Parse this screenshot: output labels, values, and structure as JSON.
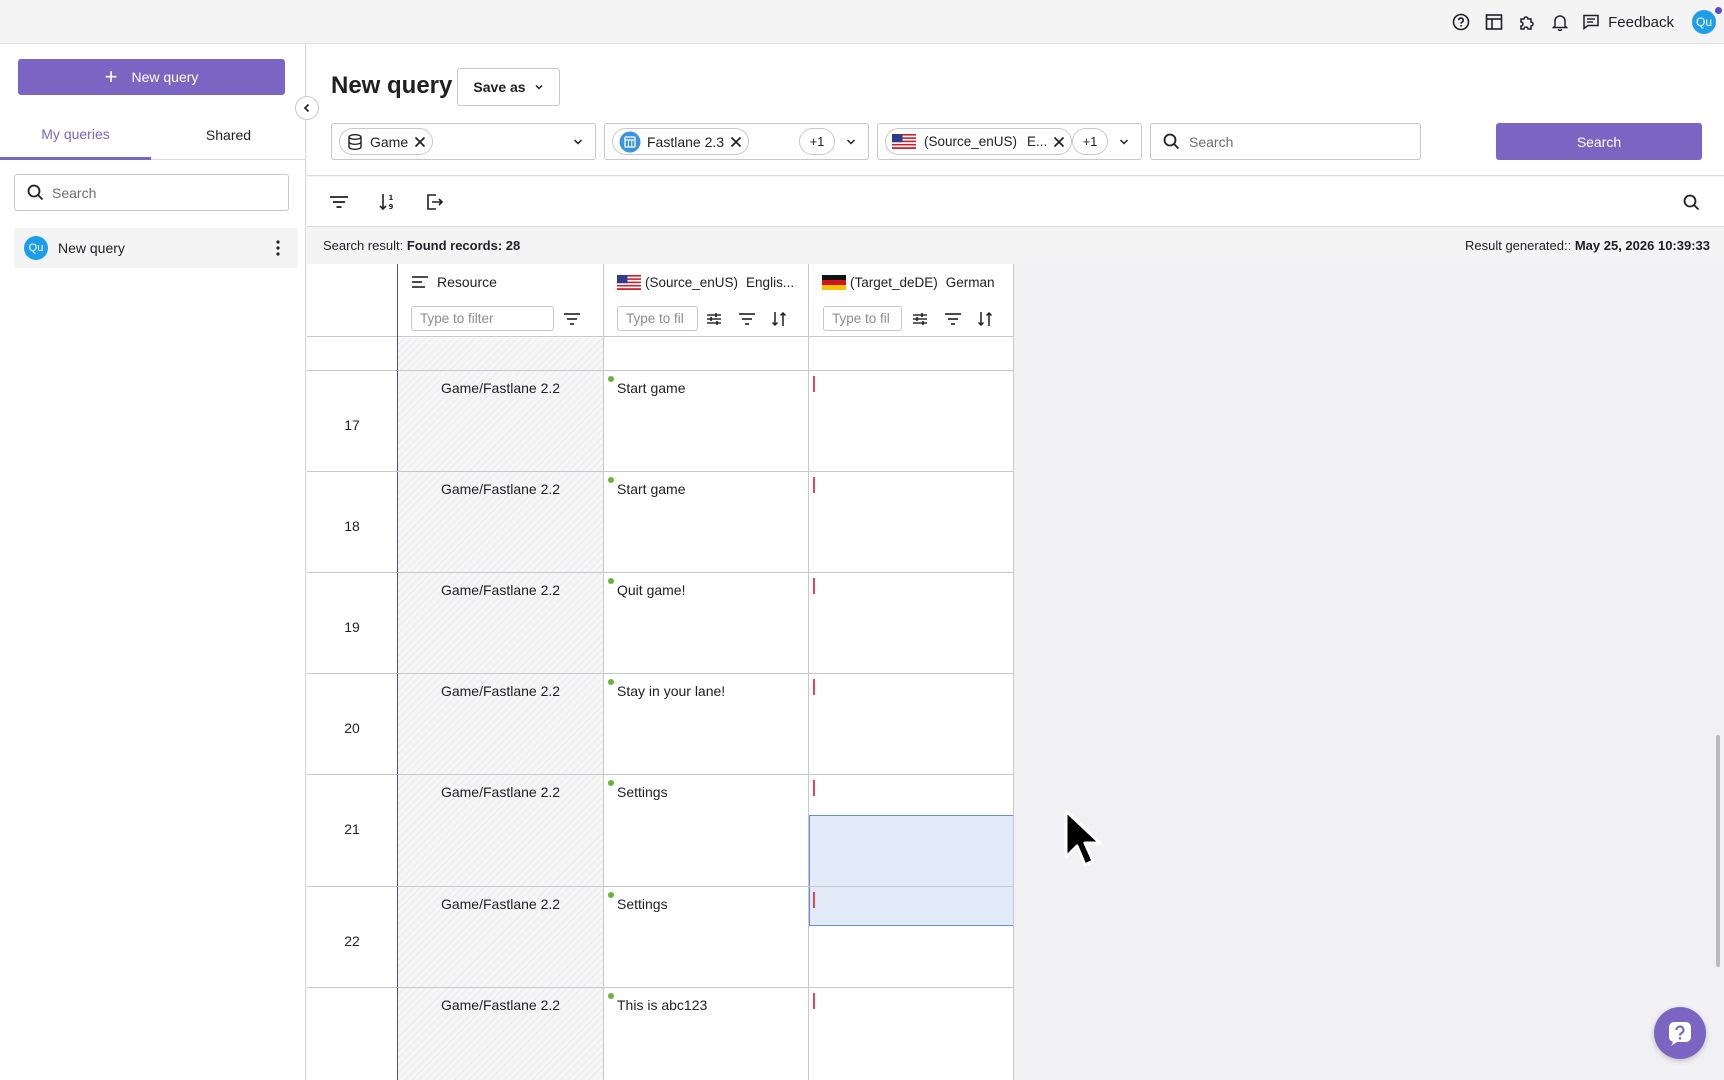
{
  "topbar": {
    "icons": [
      "help-icon",
      "layout-icon",
      "puzzle-icon",
      "bell-icon"
    ],
    "feedback_label": "Feedback",
    "avatar_initials": "Qu"
  },
  "sidebar": {
    "new_query_label": "New query",
    "tabs": [
      {
        "label": "My queries",
        "active": true
      },
      {
        "label": "Shared",
        "active": false
      }
    ],
    "search_placeholder": "Search",
    "queries": [
      {
        "avatar": "Qu",
        "label": "New query"
      }
    ]
  },
  "header": {
    "title": "New query",
    "save_as_label": "Save as",
    "filters": {
      "database_chip": "Game",
      "project_chip": "Fastlane 2.3",
      "project_more": "+1",
      "language_chip": "(Source_enUS)",
      "language_chip_suffix": "E...",
      "language_more": "+1"
    },
    "search_placeholder": "Search",
    "search_button": "Search"
  },
  "status": {
    "prefix": "Search result:",
    "found_label": "Found records: 28",
    "generated_prefix": "Result generated::",
    "generated_value": "May 25, 2026 10:39:33"
  },
  "grid": {
    "columns": [
      {
        "label": "Resource",
        "filter_placeholder": "Type to filter"
      },
      {
        "code": "(Source_enUS)",
        "label": "Englis...",
        "filter_placeholder": "Type to fil"
      },
      {
        "code": "(Target_deDE)",
        "label": "German",
        "filter_placeholder": "Type to fil"
      }
    ],
    "rows": [
      {
        "num": "17",
        "resource": "Game/Fastlane 2.2",
        "source": "Start game"
      },
      {
        "num": "18",
        "resource": "Game/Fastlane 2.2",
        "source": "Start game"
      },
      {
        "num": "19",
        "resource": "Game/Fastlane 2.2",
        "source": "Quit game!"
      },
      {
        "num": "20",
        "resource": "Game/Fastlane 2.2",
        "source": "Stay in your lane!"
      },
      {
        "num": "21",
        "resource": "Game/Fastlane 2.2",
        "source": "Settings",
        "selected": true
      },
      {
        "num": "22",
        "resource": "Game/Fastlane 2.2",
        "source": "Settings"
      },
      {
        "num": "",
        "resource": "Game/Fastlane 2.2",
        "source": "This is abc123"
      }
    ]
  },
  "colors": {
    "accent": "#7a65c2",
    "avatar": "#1e9ee8",
    "source_dot": "#6bb437",
    "target_marker": "#e0445e",
    "selection": "#e2eaf7"
  }
}
